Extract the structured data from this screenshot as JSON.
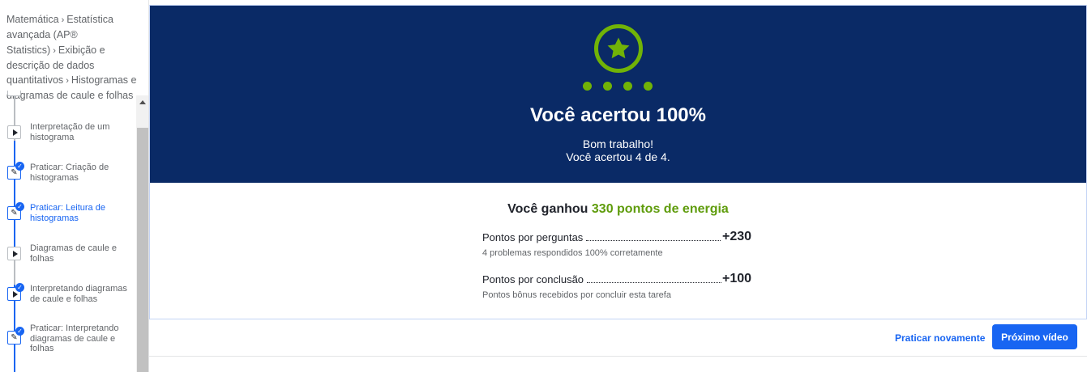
{
  "breadcrumb": [
    {
      "label": "Matemática"
    },
    {
      "label": "Estatística avançada (AP® Statistics)"
    },
    {
      "label": "Exibição e descrição de dados quantitativos"
    },
    {
      "label": "Histogramas e diagramas de caule e folhas"
    }
  ],
  "breadcrumb_separator": "›",
  "sidebar": {
    "items": [
      {
        "label": "Interpretação de um histograma",
        "type": "video",
        "completed": false
      },
      {
        "label": "Praticar: Criação de histogramas",
        "type": "exercise",
        "completed": true
      },
      {
        "label": "Praticar: Leitura de histogramas",
        "type": "exercise",
        "completed": true,
        "active": true
      },
      {
        "label": "Diagramas de caule e folhas",
        "type": "video",
        "completed": false
      },
      {
        "label": "Interpretando diagramas de caule e folhas",
        "type": "video",
        "completed": true
      },
      {
        "label": "Praticar: Interpretando diagramas de caule e folhas",
        "type": "exercise",
        "completed": true
      }
    ]
  },
  "result": {
    "title": "Você acertou 100%",
    "subtitle_line1": "Bom trabalho!",
    "subtitle_line2": "Você acertou 4 de 4.",
    "progress_dots": 4
  },
  "points": {
    "earned_prefix": "Você ganhou ",
    "earned_amount": "330 pontos de energia",
    "rows": [
      {
        "label": "Pontos por perguntas",
        "value": "+230",
        "description": "4 problemas respondidos 100% corretamente"
      },
      {
        "label": "Pontos por conclusão",
        "value": "+100",
        "description": "Pontos bônus recebidos por concluir esta tarefa"
      }
    ]
  },
  "actions": {
    "practice_again": "Praticar novamente",
    "next_video": "Próximo vídeo"
  },
  "colors": {
    "hero_bg": "#0a2a66",
    "accent_green": "#71b307",
    "energy_green": "#5f9c0c",
    "primary_blue": "#1865f2"
  }
}
